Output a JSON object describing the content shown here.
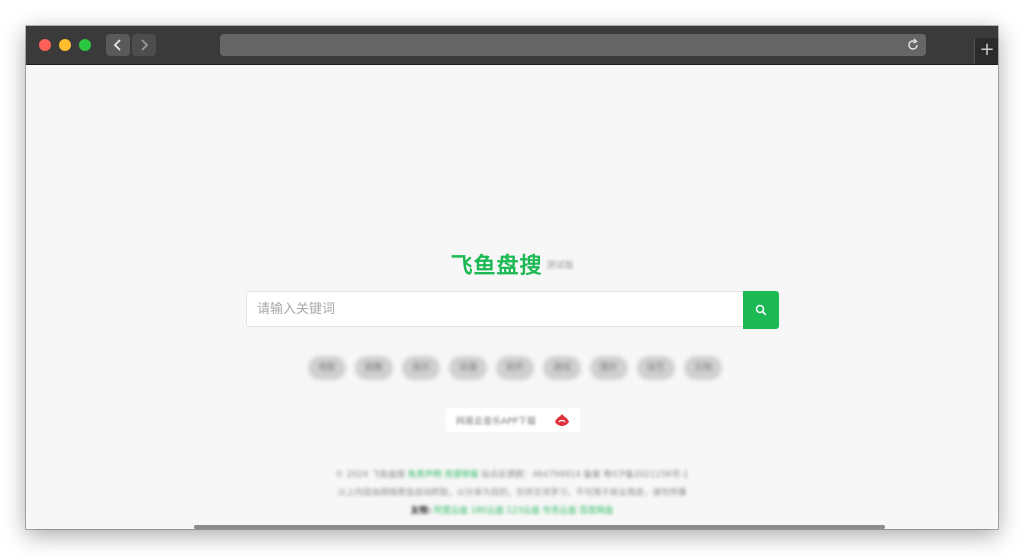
{
  "browser": {
    "new_tab_label": "+"
  },
  "site": {
    "logo": "飞鱼盘搜",
    "version": "测试版"
  },
  "search": {
    "placeholder": "请输入关键词",
    "value": ""
  },
  "tags": [
    "电影",
    "剧集",
    "音乐",
    "动漫",
    "软件",
    "游戏",
    "图片",
    "综艺",
    "文档"
  ],
  "promo": {
    "text": "网易云音乐APP下载"
  },
  "footer": {
    "line1_prefix": "© 2024 飞鱼盘搜",
    "line1_link1": "免责声明",
    "line1_link2": "资源举报",
    "line1_suffix": "站点反馈群：464794914 备案 粤ICP备2021156号-1",
    "line2": "以上内容由网络爬虫自动抓取，以分享为目的，仅供交流学习，不可用于商业用途，请勿传播",
    "line3_label": "友情:",
    "line3_links": [
      "阿里云盘",
      "180云盘",
      "123云盘",
      "夸克云盘",
      "百度网盘"
    ]
  },
  "colors": {
    "accent": "#1db954",
    "page_bg": "#f7f7f7",
    "titlebar": "#3a3a3a"
  }
}
